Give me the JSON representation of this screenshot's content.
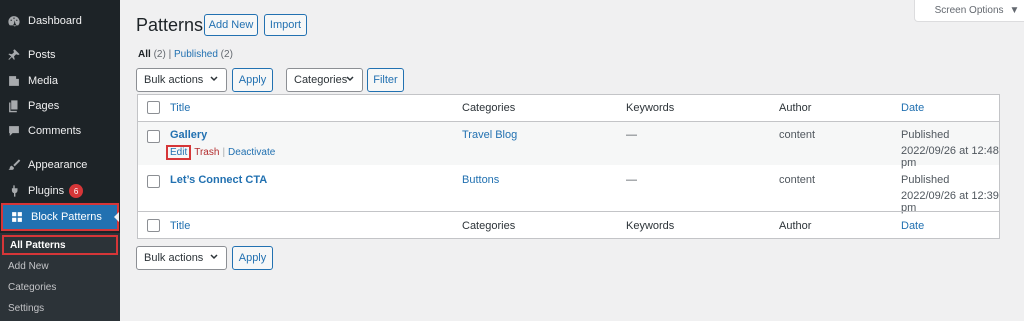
{
  "sidebar": {
    "items": [
      {
        "label": "Dashboard",
        "icon": "dashboard-icon"
      },
      {
        "label": "Posts",
        "icon": "pin-icon"
      },
      {
        "label": "Media",
        "icon": "media-icon"
      },
      {
        "label": "Pages",
        "icon": "pages-icon"
      },
      {
        "label": "Comments",
        "icon": "comment-icon"
      },
      {
        "label": "Appearance",
        "icon": "brush-icon"
      },
      {
        "label": "Plugins",
        "icon": "plugin-icon",
        "badge": "6"
      },
      {
        "label": "Block Patterns",
        "icon": "grid-icon"
      }
    ],
    "submenu": [
      {
        "label": "All Patterns"
      },
      {
        "label": "Add New"
      },
      {
        "label": "Categories"
      },
      {
        "label": "Settings"
      }
    ]
  },
  "header": {
    "title": "Patterns",
    "add_new": "Add New",
    "import": "Import",
    "screen_options": "Screen Options"
  },
  "filters": {
    "all_label": "All",
    "all_count": "(2)",
    "published_label": "Published",
    "published_count": "(2)",
    "bulk_actions": "Bulk actions",
    "apply": "Apply",
    "categories": "Categories",
    "filter": "Filter"
  },
  "table": {
    "columns": [
      "Title",
      "Categories",
      "Keywords",
      "Author",
      "Date"
    ],
    "rows": [
      {
        "title": "Gallery",
        "category": "Travel Blog",
        "keywords": "—",
        "author": "content",
        "status": "Published",
        "date": "2022/09/26 at 12:48 pm",
        "actions": {
          "edit": "Edit",
          "trash": "Trash",
          "separator": "|",
          "deactivate": "Deactivate"
        }
      },
      {
        "title": "Let’s Connect CTA",
        "category": "Buttons",
        "keywords": "—",
        "author": "content",
        "status": "Published",
        "date": "2022/09/26 at 12:39 pm"
      }
    ]
  },
  "bottom": {
    "bulk_actions": "Bulk actions",
    "apply": "Apply"
  },
  "colors": {
    "sidebar_bg": "#1d2327",
    "accent": "#2271b1",
    "highlight_border": "#d63638"
  }
}
